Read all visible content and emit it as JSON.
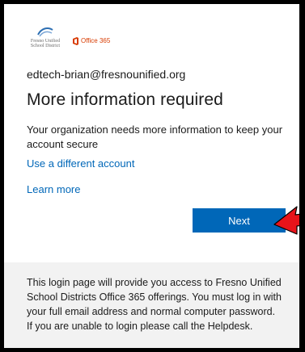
{
  "header": {
    "school_name": "Fresno Unified\nSchool District",
    "office_label": "Office 365",
    "colors": {
      "office_brand": "#d83b01"
    }
  },
  "account": {
    "email": "edtech-brian@fresnounified.org"
  },
  "main": {
    "title": "More information required",
    "description": "Your organization needs more information to keep your account secure",
    "use_different_account": "Use a different account",
    "learn_more": "Learn more",
    "next_label": "Next"
  },
  "footer": {
    "text": "This login page will provide you access to Fresno Unified School Districts Office 365 offerings. You must log in with your full email address and normal computer password. If you are unable to login please call the Helpdesk."
  },
  "colors": {
    "accent": "#0067b8",
    "footer_bg": "#f2f2f2",
    "annotation_arrow": "#e8141a"
  },
  "icons": [
    "school-logo-icon",
    "office-logo-icon",
    "red-arrow-annotation"
  ]
}
